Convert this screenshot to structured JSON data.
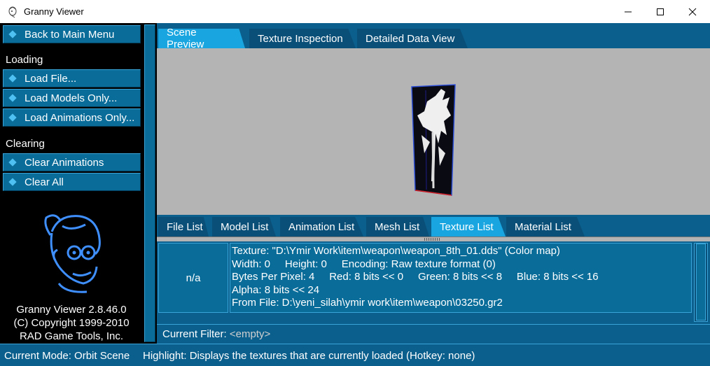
{
  "window": {
    "title": "Granny Viewer"
  },
  "sidebar": {
    "back_label": "Back to Main Menu",
    "loading_heading": "Loading",
    "loading_items": [
      "Load File...",
      "Load Models Only...",
      "Load Animations Only..."
    ],
    "clearing_heading": "Clearing",
    "clearing_items": [
      "Clear Animations",
      "Clear All"
    ],
    "about": [
      "Granny Viewer 2.8.46.0",
      "(C) Copyright 1999-2010",
      "RAD Game Tools, Inc."
    ]
  },
  "top_tabs": [
    "Scene Preview",
    "Texture Inspection",
    "Detailed Data View"
  ],
  "active_top_tab": "Scene Preview",
  "bottom_tabs": [
    "File List",
    "Model List",
    "Animation List",
    "Mesh List",
    "Texture List",
    "Material List"
  ],
  "active_bottom_tab": "Texture List",
  "texture_row": {
    "id": "n/a",
    "lines": [
      "Texture: \"D:\\Ymir Work\\item\\weapon\\weapon_8th_01.dds\" (Color map)",
      "Width: 0     Height: 0     Encoding: Raw texture format (0)",
      "Bytes Per Pixel: 4     Red: 8 bits << 0     Green: 8 bits << 8     Blue: 8 bits << 16",
      "Alpha: 8 bits << 24",
      "From File: D:\\yeni_silah\\ymir work\\item\\weapon\\03250.gr2"
    ]
  },
  "filter": {
    "label": "Current Filter:",
    "value": "<empty>"
  },
  "status": {
    "mode": "Current Mode: Orbit Scene",
    "highlight": "Highlight: Displays the textures that are currently loaded (Hotkey: none)"
  },
  "colors": {
    "panel_blue": "#0b5f8c",
    "button_blue": "#0a6c99",
    "active_tab": "#19a6e0",
    "preview_gray": "#b4b4b4"
  }
}
